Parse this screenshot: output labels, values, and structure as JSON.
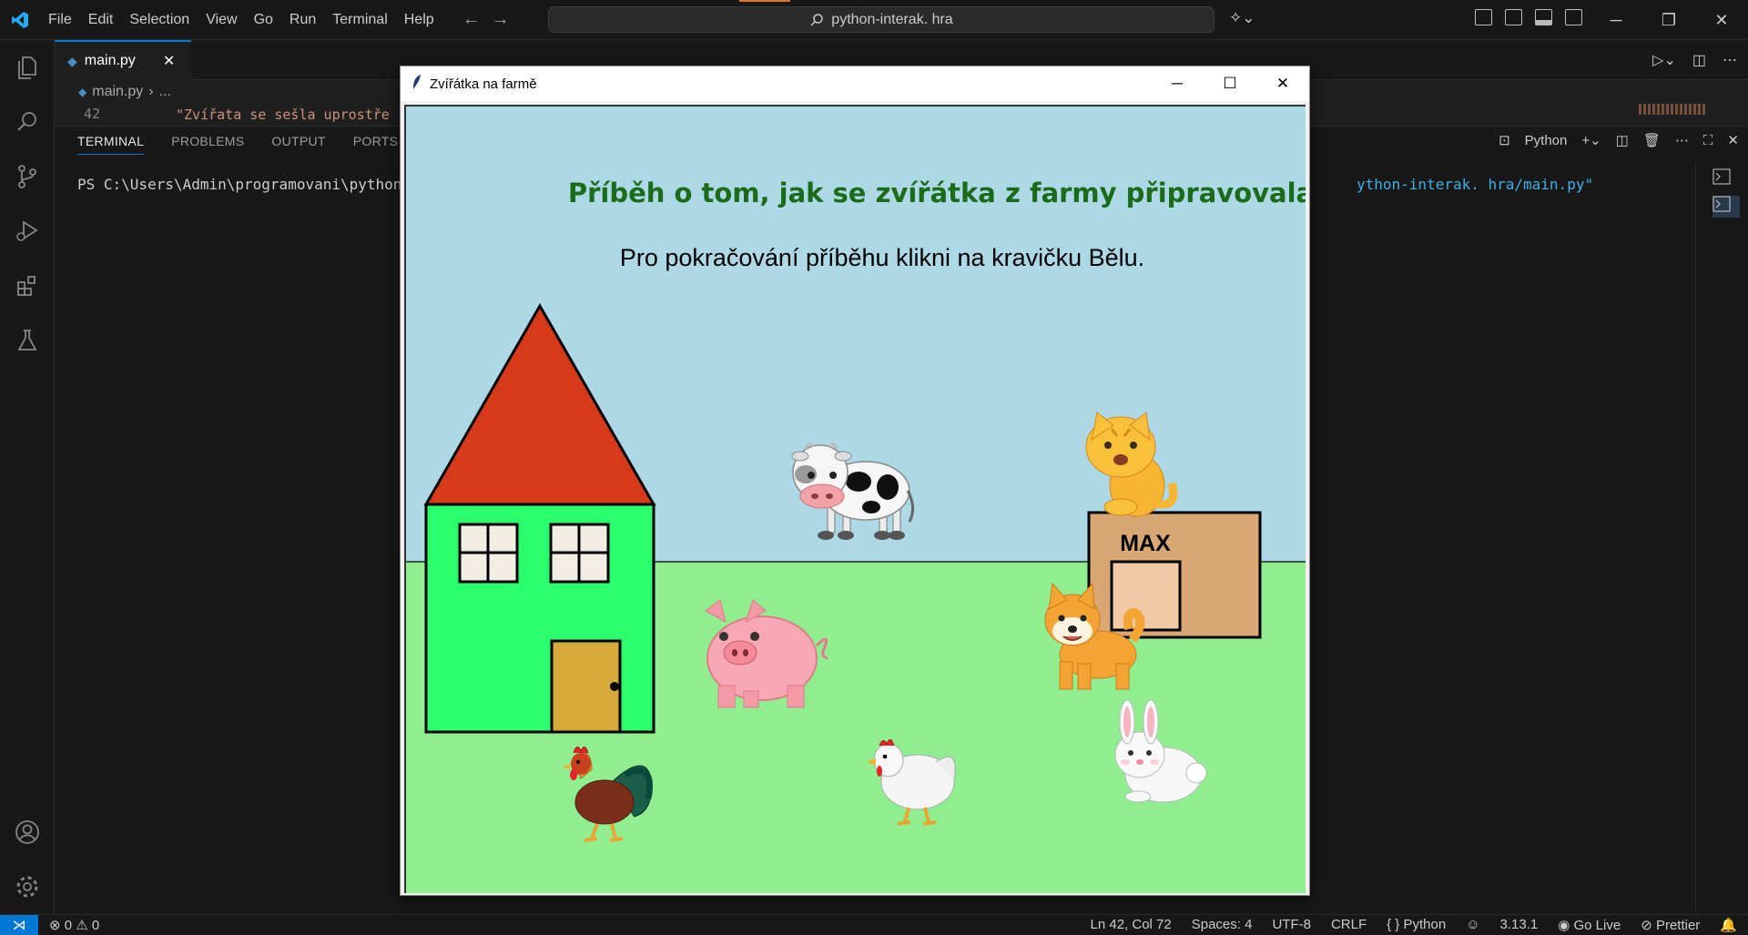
{
  "titlebar": {
    "menu": [
      "File",
      "Edit",
      "Selection",
      "View",
      "Go",
      "Run",
      "Terminal",
      "Help"
    ],
    "search_text": "python-interak. hra"
  },
  "editor": {
    "tab_label": "main.py",
    "breadcrumb_file": "main.py",
    "breadcrumb_rest": "...",
    "line_number": "42",
    "line_code": "\"Zvířata se sešla uprostře"
  },
  "panel": {
    "tabs": [
      "TERMINAL",
      "PROBLEMS",
      "OUTPUT",
      "PORTS"
    ],
    "shell_label": "Python",
    "terminal_line_left": "PS C:\\Users\\Admin\\programovani\\python-i",
    "terminal_line_right": "ython-interak. hra/main.py\""
  },
  "status": {
    "errors": "0",
    "warnings": "0",
    "position": "Ln 42, Col 72",
    "spaces": "Spaces: 4",
    "encoding": "UTF-8",
    "eol": "CRLF",
    "language": "Python",
    "version": "3.13.1",
    "golive": "Go Live",
    "prettier": "Prettier"
  },
  "tk_window": {
    "title": "Zvířátka na farmě",
    "heading": "Příběh o tom, jak se zvířátka z farmy připravovala na ples.",
    "instruction": "Pro pokračování příběhu klikni na kravičku Bělu.",
    "box_label": "MAX",
    "colors": {
      "sky": "#add8e6",
      "grass": "#90ee90",
      "roof": "#d63a18",
      "house": "#2cff6e",
      "door": "#d6aa3a",
      "box": "#d9a774",
      "heading_text": "#1a6b1a"
    }
  },
  "icons": [
    "explorer-icon",
    "search-icon",
    "source-control-icon",
    "run-debug-icon",
    "extensions-icon",
    "testing-icon",
    "account-icon",
    "settings-icon"
  ]
}
